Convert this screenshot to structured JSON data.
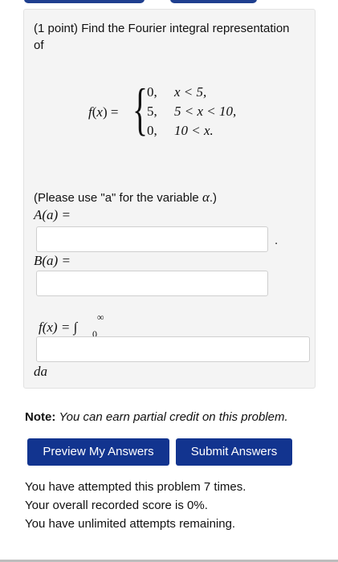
{
  "problem": {
    "intro_line1": "(1 point) Find the Fourier integral representation",
    "intro_line2": "of",
    "function_label": "f(x) =",
    "cases": [
      {
        "value": "0,",
        "condition": "x < 5,"
      },
      {
        "value": "5,",
        "condition": "5 < x < 10,"
      },
      {
        "value": "0,",
        "condition": "10 < x."
      }
    ],
    "variable_hint_prefix": "(Please use \"a\" for the variable ",
    "variable_hint_symbol": "α",
    "variable_hint_suffix": ".)",
    "A_label": "A(a) =",
    "A_value": "",
    "A_trailing": ".",
    "B_label": "B(a) =",
    "B_value": "",
    "f_label": "f(x) = ∫",
    "f_upper": "∞",
    "f_lower": "0",
    "f_value": "",
    "da_label": "da"
  },
  "note": {
    "bold": "Note:",
    "text": "You can earn partial credit on this problem."
  },
  "buttons": {
    "preview": "Preview My Answers",
    "submit": "Submit Answers"
  },
  "status": {
    "attempts": "You have attempted this problem 7 times.",
    "score": "Your overall recorded score is 0%.",
    "remaining": "You have unlimited attempts remaining."
  },
  "colors": {
    "button_bg": "#12348f",
    "panel_bg": "#f4f4f4"
  }
}
